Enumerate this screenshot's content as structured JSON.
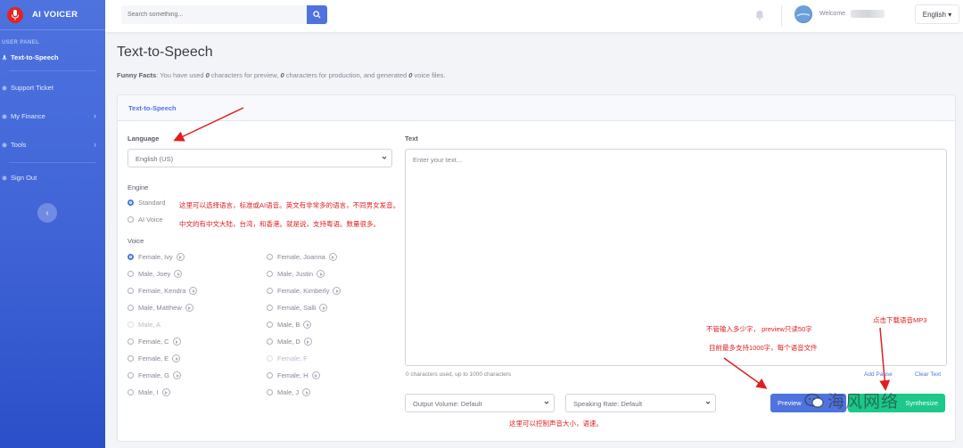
{
  "app": {
    "brand": "AI VOICER"
  },
  "sidebar": {
    "heading": "USER PANEL",
    "items": [
      {
        "label": "Text-to-Speech",
        "active": true,
        "icon": "microphone-icon"
      },
      {
        "label": "Support Ticket",
        "icon": "ticket-icon"
      },
      {
        "label": "My Finance",
        "icon": "wallet-icon",
        "has_children": true
      },
      {
        "label": "Tools",
        "icon": "wrench-icon",
        "has_children": true
      },
      {
        "label": "Sign Out",
        "icon": "sign-out-icon"
      }
    ],
    "collapse_icon": "chevron-left-icon"
  },
  "topbar": {
    "search_placeholder": "Search something...",
    "search_icon": "search-icon",
    "bell_icon": "bell-icon",
    "welcome": "Welcome",
    "language": "English ▾"
  },
  "page": {
    "title": "Text-to-Speech",
    "facts_prefix": "Funny Facts",
    "facts_1": ": You have used ",
    "facts_preview_count": "0",
    "facts_2": " characters for preview, ",
    "facts_production_count": "0",
    "facts_3": " characters for production, and generated ",
    "facts_files_count": "0",
    "facts_4": " voice files."
  },
  "form": {
    "card_title": "Text-to-Speech",
    "language_label": "Language",
    "language_value": "English (US)",
    "engine_label": "Engine",
    "engines": [
      {
        "label": "Standard",
        "checked": true
      },
      {
        "label": "AI Voice",
        "checked": false
      }
    ],
    "voice_label": "Voice",
    "voices_left": [
      {
        "label": "Female, Ivy",
        "checked": true,
        "play": true
      },
      {
        "label": "Male, Joey",
        "play": true
      },
      {
        "label": "Female, Kendra",
        "play": true
      },
      {
        "label": "Male, Matthew",
        "play": true
      },
      {
        "label": "Male, A",
        "disabled": true
      },
      {
        "label": "Female, C",
        "play": true
      },
      {
        "label": "Female, E",
        "play": true
      },
      {
        "label": "Female, G",
        "play": true
      },
      {
        "label": "Male, I",
        "play": true
      }
    ],
    "voices_right": [
      {
        "label": "Female, Joanna",
        "play": true
      },
      {
        "label": "Male, Justin",
        "play": true
      },
      {
        "label": "Female, Kimberly",
        "play": true
      },
      {
        "label": "Female, Salli",
        "play": true
      },
      {
        "label": "Male, B",
        "play": true
      },
      {
        "label": "Male, D",
        "play": true
      },
      {
        "label": "Female, F",
        "disabled": true
      },
      {
        "label": "Female, H",
        "play": true
      },
      {
        "label": "Male, J",
        "play": true
      }
    ],
    "text_label": "Text",
    "text_placeholder": "Enter your text...",
    "char_count": "0 characters used, up to 1000 characters",
    "add_pause": "Add Pause",
    "clear_text": "Clear Text",
    "output_volume": "Output Volume: Default",
    "speaking_rate": "Speaking Rate: Default",
    "preview_button": "Preview",
    "synthesize_button": "Synthesize"
  },
  "annotations": {
    "a1": "这里可以选择语言，标准或AI语音。英文有非常多的语言，不同男女发音。",
    "a2": "中文的有中文大陆，台湾，和香港。就是说，支持粤语。数量很多。",
    "a3": "不管输入多少字， preview只读50字",
    "a4": "目前最多支持1000字，每个语音文件",
    "a5": "点击下载语音MP3",
    "a6": "这里可以控制声音大小，语速。"
  },
  "watermark": {
    "text": "海风网络"
  },
  "colors": {
    "primary": "#4e73df",
    "success": "#1cc88a",
    "annotation": "#e02020"
  }
}
